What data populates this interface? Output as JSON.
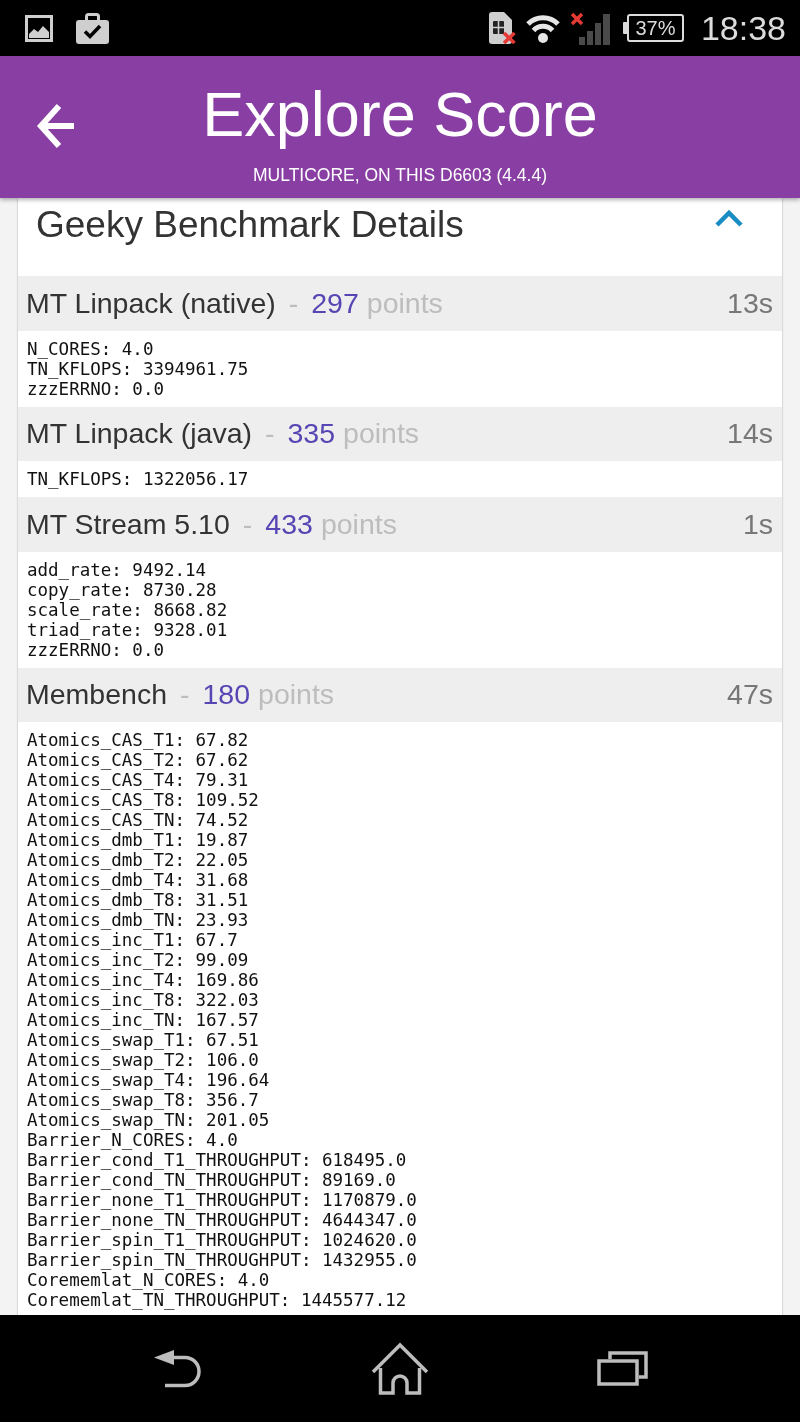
{
  "status_bar": {
    "battery": "37%",
    "time": "18:38"
  },
  "app_bar": {
    "title": "Explore Score",
    "subtitle": "MULTICORE, ON THIS D6603 (4.4.4)"
  },
  "details_card": {
    "title": "Geeky Benchmark Details",
    "expanded": true,
    "benchmarks": [
      {
        "name": "MT Linpack (native)",
        "separator": "-",
        "score": "297",
        "unit": "points",
        "duration": "13s",
        "details": [
          "N_CORES: 4.0",
          "TN_KFLOPS: 3394961.75",
          "zzzERRNO: 0.0"
        ]
      },
      {
        "name": "MT Linpack (java)",
        "separator": "-",
        "score": "335",
        "unit": "points",
        "duration": "14s",
        "details": [
          "TN_KFLOPS: 1322056.17"
        ]
      },
      {
        "name": "MT Stream 5.10",
        "separator": "-",
        "score": "433",
        "unit": "points",
        "duration": "1s",
        "details": [
          "add_rate: 9492.14",
          "copy_rate: 8730.28",
          "scale_rate: 8668.82",
          "triad_rate: 9328.01",
          "zzzERRNO: 0.0"
        ]
      },
      {
        "name": "Membench",
        "separator": "-",
        "score": "180",
        "unit": "points",
        "duration": "47s",
        "details": [
          "Atomics_CAS_T1: 67.82",
          "Atomics_CAS_T2: 67.62",
          "Atomics_CAS_T4: 79.31",
          "Atomics_CAS_T8: 109.52",
          "Atomics_CAS_TN: 74.52",
          "Atomics_dmb_T1: 19.87",
          "Atomics_dmb_T2: 22.05",
          "Atomics_dmb_T4: 31.68",
          "Atomics_dmb_T8: 31.51",
          "Atomics_dmb_TN: 23.93",
          "Atomics_inc_T1: 67.7",
          "Atomics_inc_T2: 99.09",
          "Atomics_inc_T4: 169.86",
          "Atomics_inc_T8: 322.03",
          "Atomics_inc_TN: 167.57",
          "Atomics_swap_T1: 67.51",
          "Atomics_swap_T2: 106.0",
          "Atomics_swap_T4: 196.64",
          "Atomics_swap_T8: 356.7",
          "Atomics_swap_TN: 201.05",
          "Barrier_N_CORES: 4.0",
          "Barrier_cond_T1_THROUGHPUT: 618495.0",
          "Barrier_cond_TN_THROUGHPUT: 89169.0",
          "Barrier_none_T1_THROUGHPUT: 1170879.0",
          "Barrier_none_TN_THROUGHPUT: 4644347.0",
          "Barrier_spin_T1_THROUGHPUT: 1024620.0",
          "Barrier_spin_TN_THROUGHPUT: 1432955.0",
          "Corememlat_N_CORES: 4.0",
          "Corememlat_TN_THROUGHPUT: 1445577.12"
        ]
      }
    ]
  }
}
